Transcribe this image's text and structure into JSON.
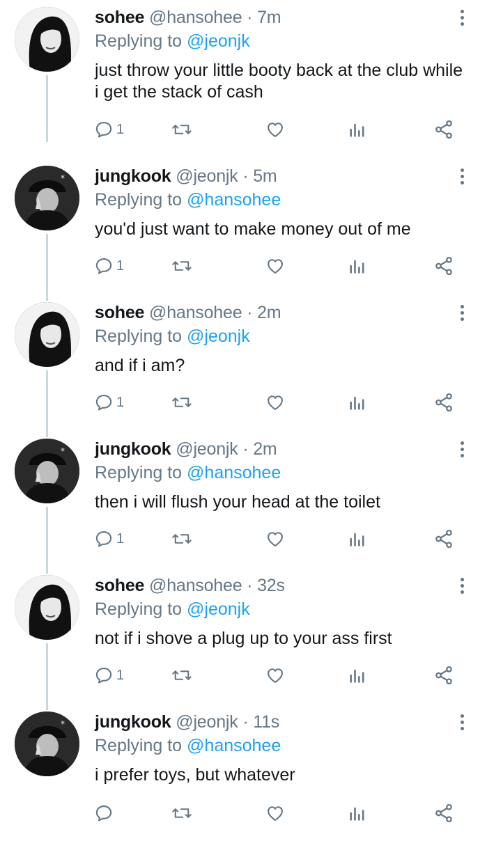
{
  "tweets": [
    {
      "name": "sohee",
      "handle": "@hansohee",
      "dot": "·",
      "time": "7m",
      "replying_prefix": "Replying to ",
      "replying_to": "@jeonjk",
      "text": "just throw your little booty back at the club while i get the stack of cash",
      "reply_count": "1",
      "avatar": "sohee"
    },
    {
      "name": "jungkook",
      "handle": "@jeonjk",
      "dot": "·",
      "time": "5m",
      "replying_prefix": "Replying to ",
      "replying_to": "@hansohee",
      "text": "you'd just want to make money out of me",
      "reply_count": "1",
      "avatar": "jungkook"
    },
    {
      "name": "sohee",
      "handle": "@hansohee",
      "dot": "·",
      "time": "2m",
      "replying_prefix": "Replying to ",
      "replying_to": "@jeonjk",
      "text": "and if i am?",
      "reply_count": "1",
      "avatar": "sohee"
    },
    {
      "name": "jungkook",
      "handle": "@jeonjk",
      "dot": "·",
      "time": "2m",
      "replying_prefix": "Replying to ",
      "replying_to": "@hansohee",
      "text": "then i will flush your head at the toilet",
      "reply_count": "1",
      "avatar": "jungkook"
    },
    {
      "name": "sohee",
      "handle": "@hansohee",
      "dot": "·",
      "time": "32s",
      "replying_prefix": "Replying to ",
      "replying_to": "@jeonjk",
      "text": "not if i shove a plug up to your ass first",
      "reply_count": "1",
      "avatar": "sohee"
    },
    {
      "name": "jungkook",
      "handle": "@jeonjk",
      "dot": "·",
      "time": "11s",
      "replying_prefix": "Replying to ",
      "replying_to": "@hansohee",
      "text": "i prefer toys, but whatever",
      "reply_count": "",
      "avatar": "jungkook"
    }
  ],
  "icons": {
    "reply": "reply-icon",
    "retweet": "retweet-icon",
    "like": "heart-icon",
    "stats": "analytics-icon",
    "share": "share-icon",
    "more": "more-vertical-icon"
  },
  "colors": {
    "link": "#1da1f2",
    "muted": "#657786",
    "text": "#14171a",
    "thread_line": "#ccd6dd"
  }
}
